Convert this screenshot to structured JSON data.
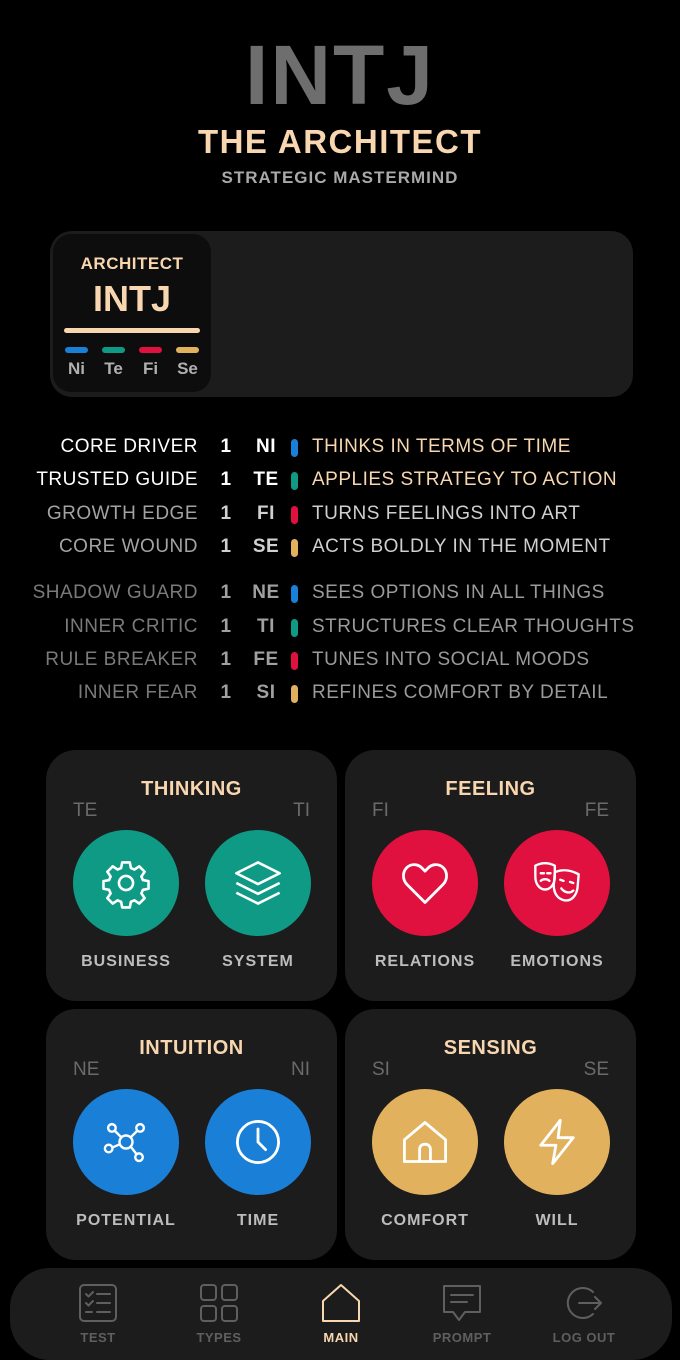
{
  "header": {
    "type_code": "INTJ",
    "type_name": "THE ARCHITECT",
    "subtitle": "STRATEGIC MASTERMIND"
  },
  "badge": {
    "title": "ARCHITECT",
    "code": "INTJ",
    "functions": [
      {
        "label": "Ni",
        "color": "#1a7fd6"
      },
      {
        "label": "Te",
        "color": "#0f9a85"
      },
      {
        "label": "Fi",
        "color": "#e0103f"
      },
      {
        "label": "Se",
        "color": "#e2b15e"
      }
    ]
  },
  "roles": [
    {
      "name": "CORE DRIVER",
      "num": "1",
      "func": "NI",
      "color": "#1a7fd6",
      "desc": "THINKS IN TERMS OF TIME"
    },
    {
      "name": "TRUSTED GUIDE",
      "num": "1",
      "func": "TE",
      "color": "#0f9a85",
      "desc": "APPLIES STRATEGY TO ACTION"
    },
    {
      "name": "GROWTH EDGE",
      "num": "1",
      "func": "FI",
      "color": "#e0103f",
      "desc": "TURNS FEELINGS INTO ART"
    },
    {
      "name": "CORE WOUND",
      "num": "1",
      "func": "SE",
      "color": "#e2b15e",
      "desc": "ACTS BOLDLY IN THE MOMENT"
    },
    {
      "name": "SHADOW GUARD",
      "num": "1",
      "func": "NE",
      "color": "#1a7fd6",
      "desc": "SEES OPTIONS IN ALL THINGS"
    },
    {
      "name": "INNER CRITIC",
      "num": "1",
      "func": "TI",
      "color": "#0f9a85",
      "desc": "STRUCTURES CLEAR THOUGHTS"
    },
    {
      "name": "RULE BREAKER",
      "num": "1",
      "func": "FE",
      "color": "#e0103f",
      "desc": "TUNES INTO SOCIAL MOODS"
    },
    {
      "name": "INNER FEAR",
      "num": "1",
      "func": "SI",
      "color": "#e2b15e",
      "desc": "REFINES COMFORT BY DETAIL"
    }
  ],
  "quadrants": {
    "thinking": {
      "title": "THINKING",
      "left": "TE",
      "right": "TI",
      "color": "#0f9a85",
      "items": [
        {
          "label": "BUSINESS",
          "icon": "gear-icon"
        },
        {
          "label": "SYSTEM",
          "icon": "layers-icon"
        }
      ]
    },
    "feeling": {
      "title": "FEELING",
      "left": "FI",
      "right": "FE",
      "color": "#e0103f",
      "items": [
        {
          "label": "RELATIONS",
          "icon": "heart-icon"
        },
        {
          "label": "EMOTIONS",
          "icon": "theater-masks-icon"
        }
      ]
    },
    "intuition": {
      "title": "INTUITION",
      "left": "NE",
      "right": "NI",
      "color": "#1a7fd6",
      "items": [
        {
          "label": "POTENTIAL",
          "icon": "network-icon"
        },
        {
          "label": "TIME",
          "icon": "clock-icon"
        }
      ]
    },
    "sensing": {
      "title": "SENSING",
      "left": "SI",
      "right": "SE",
      "color": "#e2b15e",
      "items": [
        {
          "label": "COMFORT",
          "icon": "home-icon"
        },
        {
          "label": "WILL",
          "icon": "lightning-icon"
        }
      ]
    }
  },
  "nav": {
    "items": [
      {
        "label": "TEST",
        "icon": "checklist-icon",
        "active": false
      },
      {
        "label": "TYPES",
        "icon": "grid-icon",
        "active": false
      },
      {
        "label": "MAIN",
        "icon": "home-icon",
        "active": true
      },
      {
        "label": "PROMPT",
        "icon": "chat-icon",
        "active": false
      },
      {
        "label": "LOG OUT",
        "icon": "logout-icon",
        "active": false
      }
    ]
  }
}
